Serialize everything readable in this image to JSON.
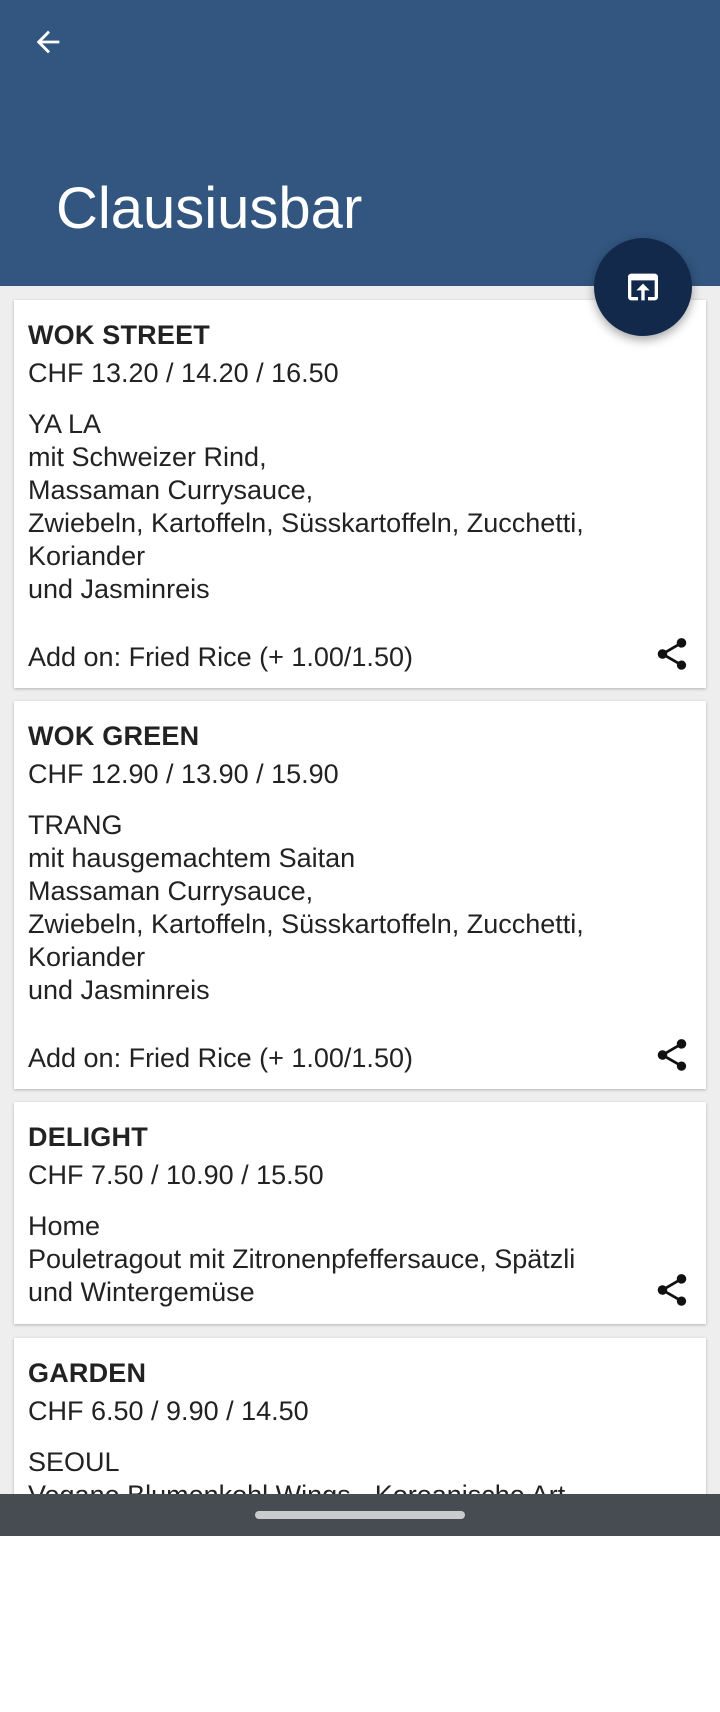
{
  "header": {
    "title": "Clausiusbar",
    "background_color": "#32567f",
    "back_icon": "arrow-back-icon",
    "fab_icon": "open-in-browser-icon",
    "fab_color": "#13294b"
  },
  "menus": [
    {
      "name": "WOK STREET",
      "price": "CHF 13.20 / 14.20 / 16.50",
      "description": "YA LA\nmit Schweizer Rind,\nMassaman Currysauce,\nZwiebeln, Kartoffeln, Süsskartoffeln, Zucchetti,\nKoriander\nund Jasminreis",
      "addon": "Add on: Fried Rice (+ 1.00/1.50)"
    },
    {
      "name": "WOK GREEN",
      "price": "CHF 12.90 / 13.90 / 15.90",
      "description": "TRANG\nmit hausgemachtem Saitan\nMassaman Currysauce,\nZwiebeln, Kartoffeln, Süsskartoffeln, Zucchetti,\nKoriander\nund Jasminreis",
      "addon": "Add on: Fried Rice (+ 1.00/1.50)"
    },
    {
      "name": "DELIGHT",
      "price": "CHF 7.50 / 10.90 / 15.50",
      "description": "Home\nPouletragout mit Zitronenpfeffersauce, Spätzli\nund Wintergemüse"
    },
    {
      "name": "GARDEN",
      "price": "CHF 6.50 / 9.90 / 14.50",
      "description": "SEOUL\nVegane Blumenkohl Wings - Koreanische Art"
    }
  ],
  "share_icon": "share-icon",
  "nav_bar_color": "#464c51"
}
